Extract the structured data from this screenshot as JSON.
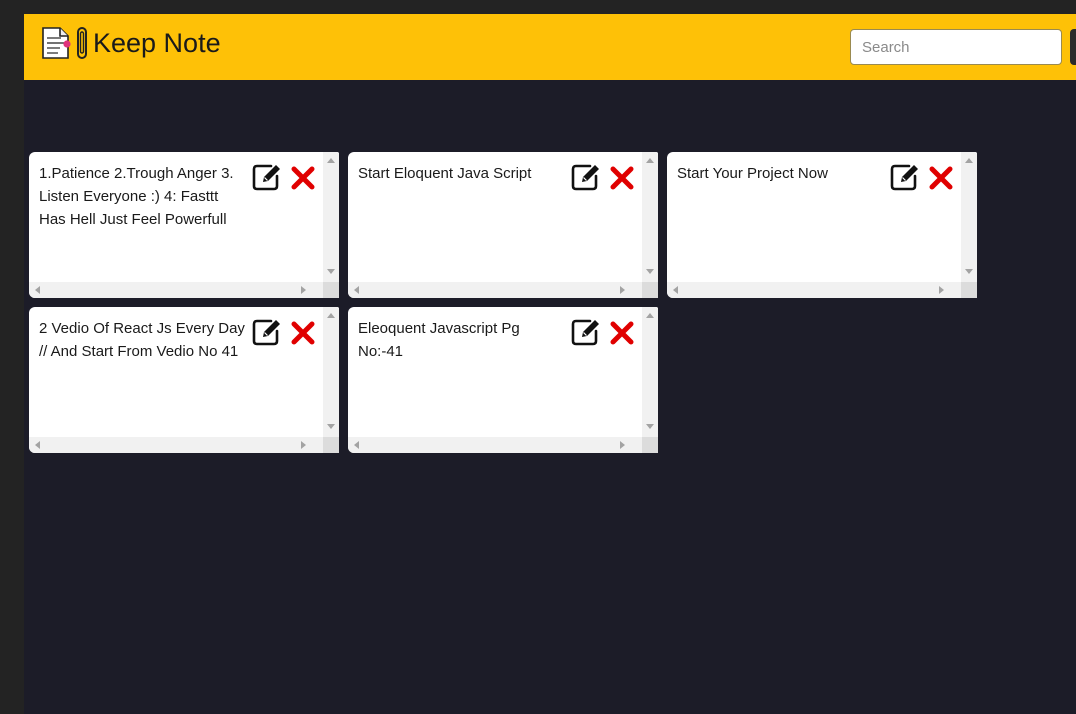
{
  "app": {
    "title": "Keep Note",
    "logo_icon": "notepad-paperclip-icon",
    "header_color": "#fec107",
    "background_color": "#1c1c28"
  },
  "search": {
    "placeholder": "Search",
    "value": ""
  },
  "notes": [
    {
      "text": "1.Patience 2.Trough Anger 3. Listen Everyone :) 4: Fasttt Has Hell Just Feel Powerfull"
    },
    {
      "text": "Start Eloquent Java Script"
    },
    {
      "text": "Start Your Project Now"
    },
    {
      "text": "2 Vedio Of React Js Every Day // And Start From Vedio No 41"
    },
    {
      "text": "Eleoquent Javascript Pg No:-41"
    }
  ],
  "icons": {
    "edit": "edit-icon",
    "delete": "delete-icon",
    "delete_color": "#e00000"
  }
}
